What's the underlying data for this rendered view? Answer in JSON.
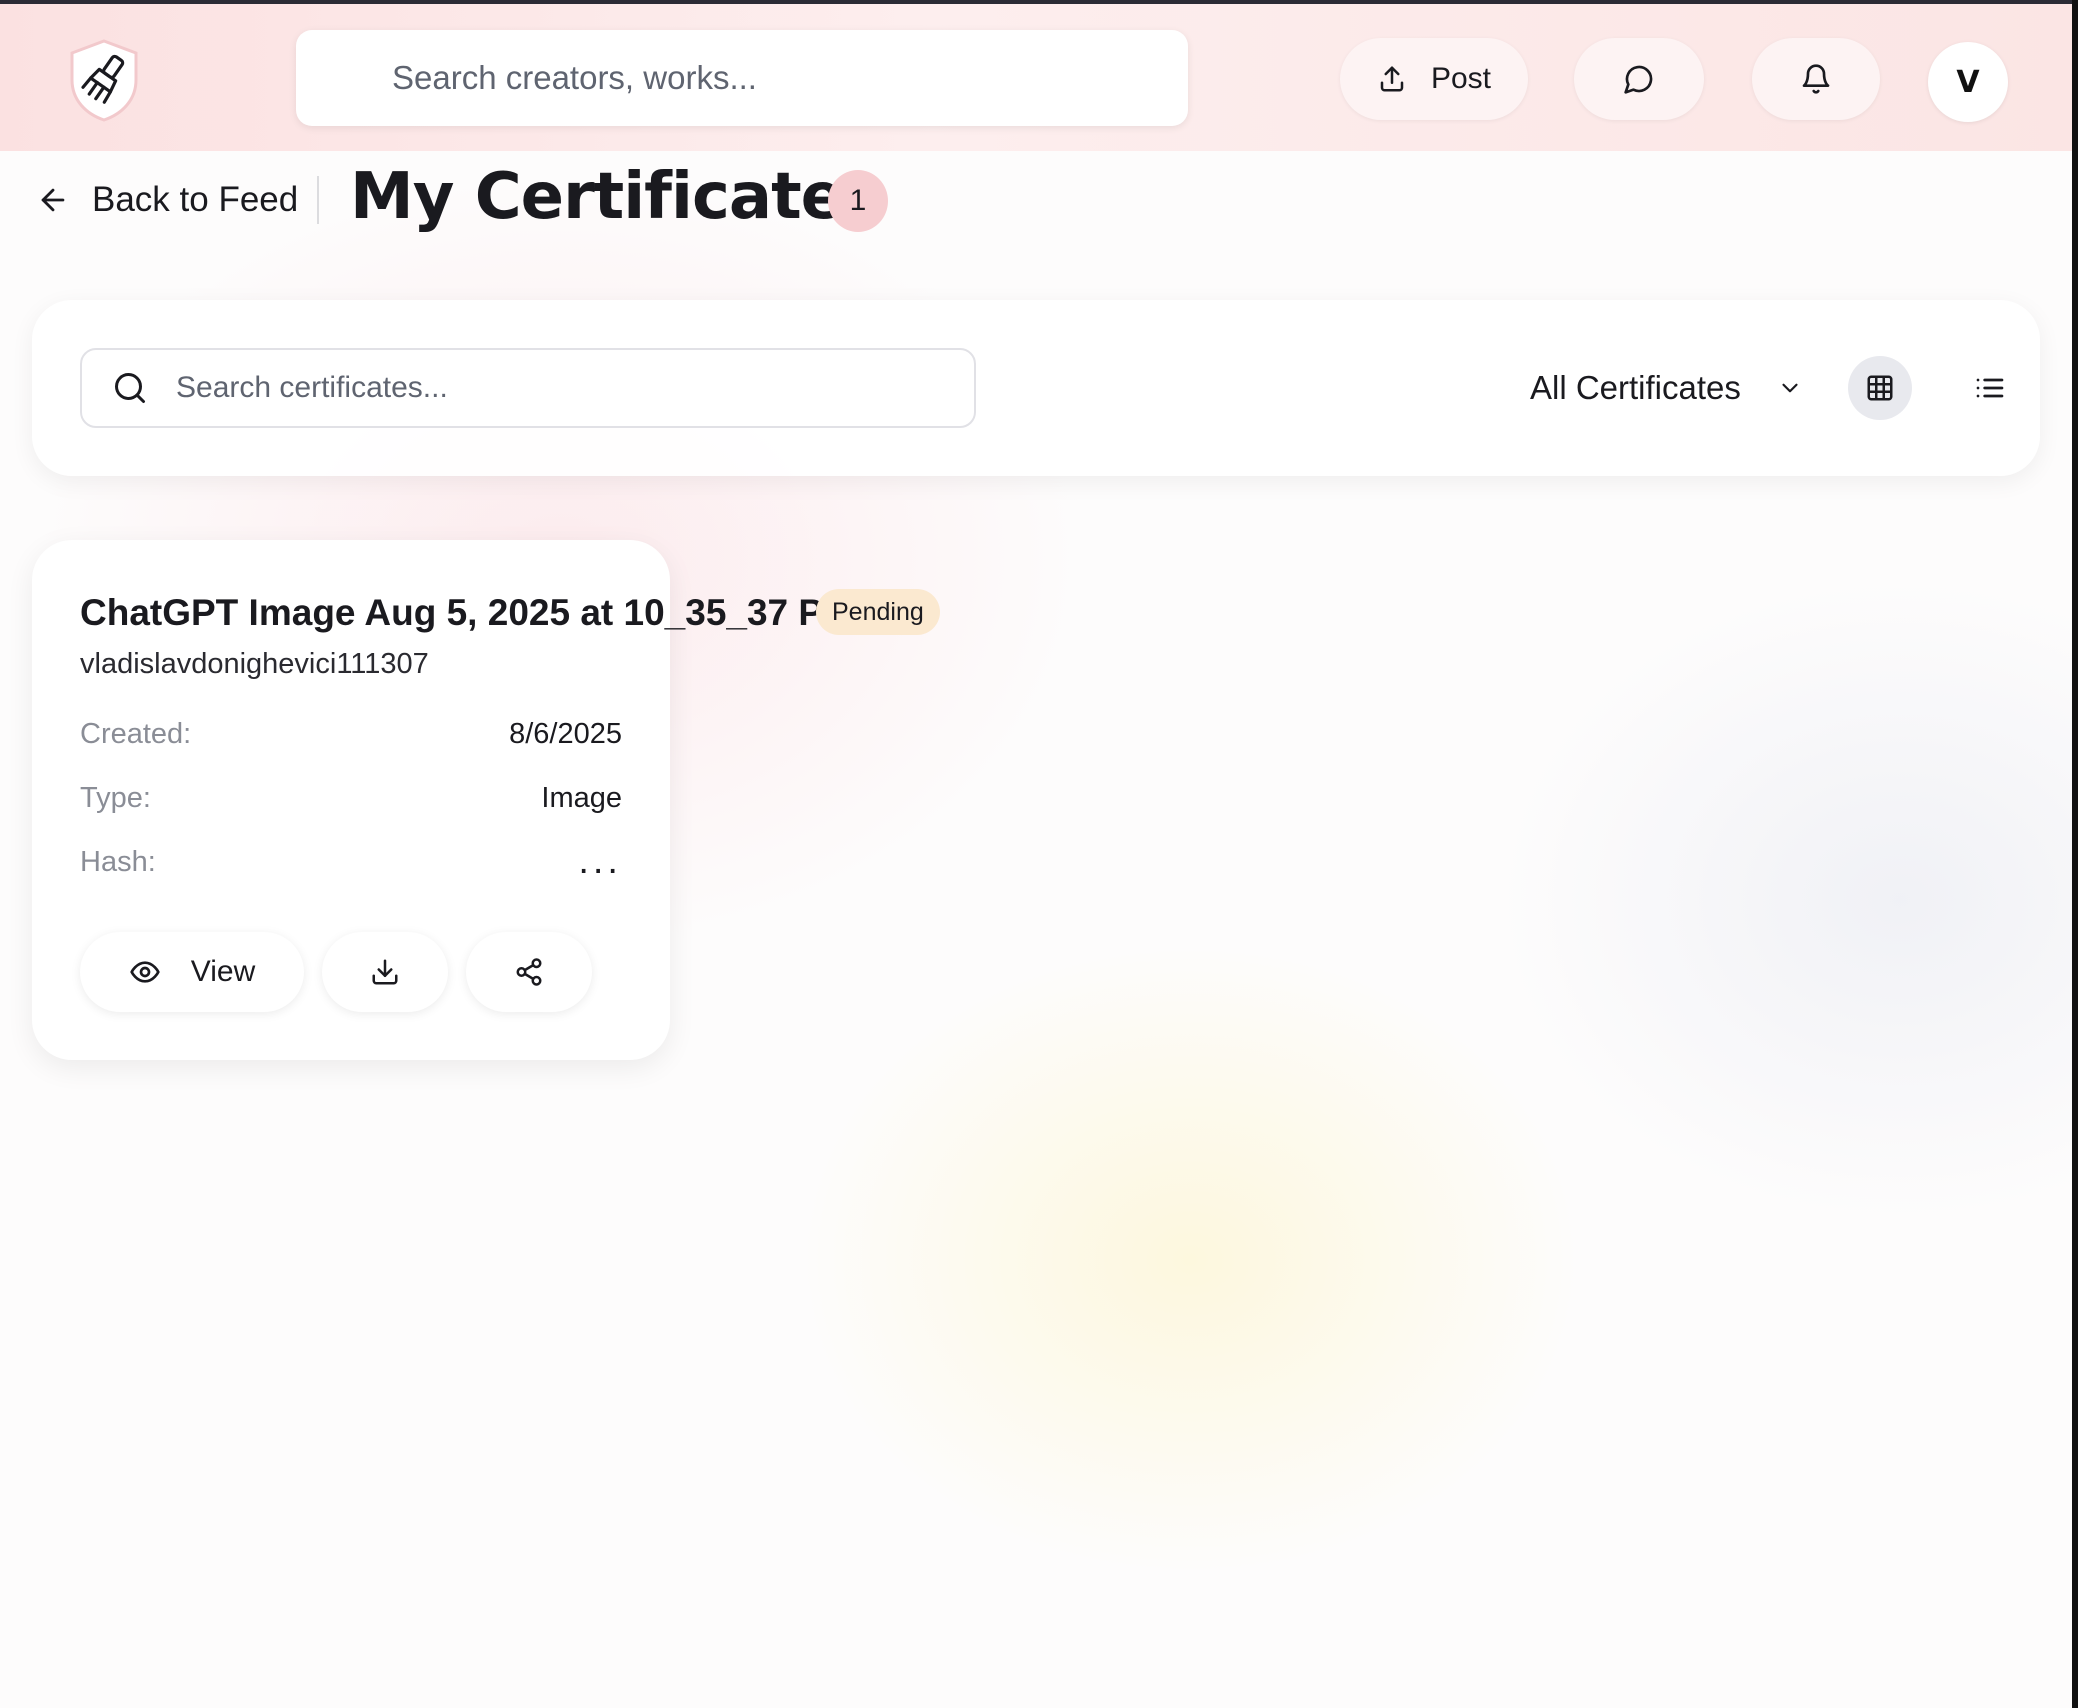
{
  "header": {
    "search_placeholder": "Search creators, works...",
    "post_label": "Post",
    "avatar_initial": "V"
  },
  "page": {
    "back_label": "Back to Feed",
    "title": "My Certificates",
    "count": "1"
  },
  "filters": {
    "search_placeholder": "Search certificates...",
    "type_selected": "All Certificates",
    "view_mode": "grid"
  },
  "certificates": [
    {
      "title": "ChatGPT Image Aug 5, 2025 at 10_35_37 PM",
      "status": "Pending",
      "owner": "vladislavdonighevici111307",
      "created_label": "Created:",
      "created_value": "8/6/2025",
      "type_label": "Type:",
      "type_value": "Image",
      "hash_label": "Hash:",
      "hash_value": "...",
      "view_label": "View"
    }
  ],
  "colors": {
    "header_bg": "#fbe1e1",
    "count_badge": "#f6cdd0",
    "pending_badge": "#fbe9d0",
    "grid_toggle_active": "#e8e9ee"
  },
  "icons": [
    "brush-shield-logo",
    "upload-icon",
    "message-icon",
    "bell-icon",
    "arrow-left-icon",
    "search-icon",
    "chevron-down-icon",
    "grid-icon",
    "list-icon",
    "eye-icon",
    "download-icon",
    "share-icon"
  ]
}
